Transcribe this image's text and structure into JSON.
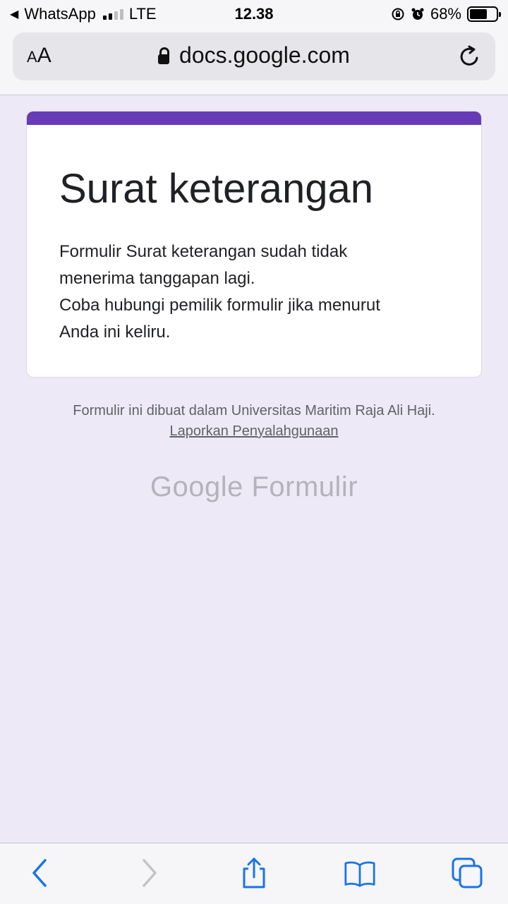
{
  "status_bar": {
    "back_app": "WhatsApp",
    "network": "LTE",
    "time": "12.38",
    "battery": "68%",
    "battery_level": 0.68
  },
  "browser": {
    "text_size_label_small": "A",
    "text_size_label_large": "A",
    "url": "docs.google.com"
  },
  "form": {
    "accent_color": "#673ab7",
    "title": "Surat keterangan",
    "message_lines": [
      "Formulir Surat keterangan sudah tidak",
      "menerima tanggapan lagi.",
      "Coba hubungi pemilik formulir jika menurut",
      "Anda ini keliru."
    ]
  },
  "footer": {
    "text": "Formulir ini dibuat dalam Universitas Maritim Raja Ali Haji.",
    "report_link": "Laporkan Penyalahgunaan",
    "logo_google": "Google",
    "logo_product": "Formulir"
  },
  "toolbar": {
    "icons": [
      "back-icon",
      "forward-icon",
      "share-icon",
      "bookmarks-icon",
      "tabs-icon"
    ]
  }
}
